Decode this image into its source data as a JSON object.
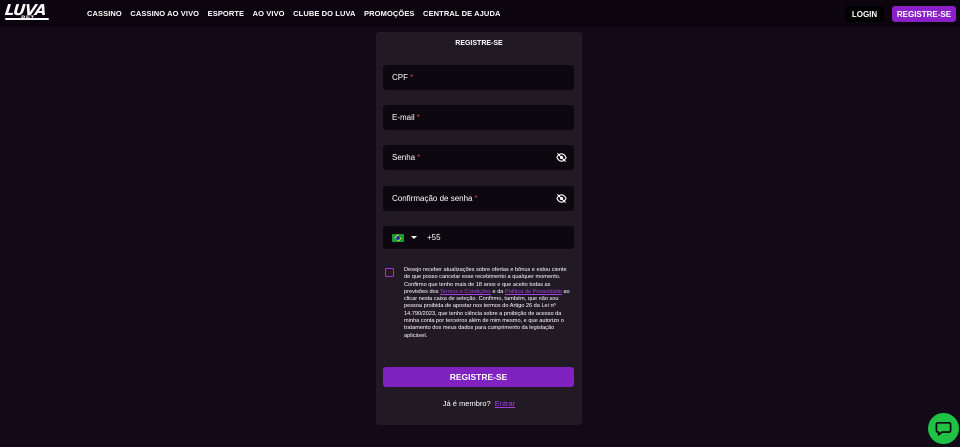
{
  "brand": {
    "logo_text": "LUVA",
    "logo_sub": ".BET"
  },
  "nav": {
    "items": [
      "CASSINO",
      "CASSINO AO VIVO",
      "ESPORTE",
      "AO VIVO",
      "CLUBE DO LUVA",
      "PROMOÇÕES",
      "CENTRAL DE AJUDA"
    ]
  },
  "header": {
    "login_label": "LOGIN",
    "register_label": "REGISTRE-SE"
  },
  "form": {
    "title": "REGISTRE-SE",
    "cpf_label": "CPF",
    "email_label": "E-mail",
    "password_label": "Senha",
    "confirm_label": "Confirmação de senha",
    "required_mark": "*",
    "phone_code": "+55",
    "consent": {
      "text_1": "Desejo receber atualizações sobre ofertas e bônus e estou ciente de que posso cancelar esse recebimento a qualquer momento. Confirmo que tenho mais de 18 anos e que aceito todas as previsões dos ",
      "terms_link": "Termos e Condições",
      "text_2": " e da ",
      "privacy_link": "Política de Privacidade",
      "text_3": " ao clicar nesta caixa de seleção. Confirmo, também, que não sou pessoa proibida de apostar nos termos do Artigo 26 da Lei nº 14.790/2023, que tenho ciência sobre a proibição de acesso da minha conta por terceiros além de mim mesmo, e que autorizo o tratamento dos meus dados para cumprimento da legislação aplicável."
    },
    "submit_label": "REGISTRE-SE",
    "member_text": "Já é membro?",
    "login_link": "Entrar"
  },
  "colors": {
    "accent": "#8b20c8",
    "background": "#130a17",
    "panel": "#211a25",
    "chat": "#1fc244"
  },
  "icons": [
    "logo",
    "eye-off-icon",
    "brazil-flag-icon",
    "chevron-down-icon",
    "chat-icon"
  ]
}
